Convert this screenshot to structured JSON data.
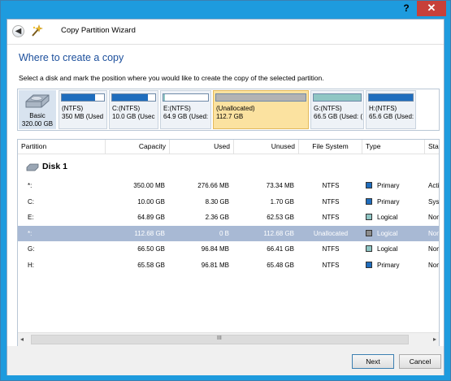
{
  "window": {
    "help_label": "?",
    "close_label": "✕"
  },
  "header": {
    "back_icon": "back-arrow-icon",
    "title": "Copy Partition Wizard"
  },
  "page": {
    "title": "Where to create a copy",
    "instruction": "Select a disk and mark the position where you would like to create the copy of the selected partition."
  },
  "disk_map": {
    "disk_label": "Basic",
    "disk_size": "320.00 GB",
    "partitions": [
      {
        "line1": "(NTFS)",
        "line2": "350 MB (Used",
        "fill_pct": 79,
        "fill_color": "#1f6dbd",
        "selected": false
      },
      {
        "line1": "C:(NTFS)",
        "line2": "10.0 GB (Usec",
        "fill_pct": 83,
        "fill_color": "#1f6dbd",
        "selected": false
      },
      {
        "line1": "E:(NTFS)",
        "line2": "64.9 GB (Used:",
        "fill_pct": 4,
        "fill_color": "#8fc6c4",
        "selected": false
      },
      {
        "line1": "(Unallocated)",
        "line2": "112.7 GB",
        "fill_pct": 100,
        "fill_color": "#b3b3b3",
        "selected": true
      },
      {
        "line1": "G:(NTFS)",
        "line2": "66.5 GB (Used: (",
        "fill_pct": 100,
        "fill_color": "#8fc6c4",
        "selected": false
      },
      {
        "line1": "H:(NTFS)",
        "line2": "65.6 GB (Used:",
        "fill_pct": 100,
        "fill_color": "#1f6dbd",
        "selected": false
      }
    ]
  },
  "table": {
    "columns": [
      "Partition",
      "Capacity",
      "Used",
      "Unused",
      "File System",
      "Type",
      "Status"
    ],
    "disk_title": "Disk 1",
    "rows": [
      {
        "partition": "*:",
        "capacity": "350.00 MB",
        "used": "276.66 MB",
        "unused": "73.34 MB",
        "fs": "NTFS",
        "type": "Primary",
        "type_color": "#1f6dbd",
        "status": "Active"
      },
      {
        "partition": "C:",
        "capacity": "10.00 GB",
        "used": "8.30 GB",
        "unused": "1.70 GB",
        "fs": "NTFS",
        "type": "Primary",
        "type_color": "#1f6dbd",
        "status": "Syster"
      },
      {
        "partition": "E:",
        "capacity": "64.89 GB",
        "used": "2.36 GB",
        "unused": "62.53 GB",
        "fs": "NTFS",
        "type": "Logical",
        "type_color": "#8fc6c4",
        "status": "None"
      },
      {
        "partition": "*:",
        "capacity": "112.68 GB",
        "used": "0 B",
        "unused": "112.68 GB",
        "fs": "Unallocated",
        "type": "Logical",
        "type_color": "#8c8c8c",
        "status": "None"
      },
      {
        "partition": "G:",
        "capacity": "66.50 GB",
        "used": "96.84 MB",
        "unused": "66.41 GB",
        "fs": "NTFS",
        "type": "Logical",
        "type_color": "#8fc6c4",
        "status": "None"
      },
      {
        "partition": "H:",
        "capacity": "65.58 GB",
        "used": "96.81 MB",
        "unused": "65.48 GB",
        "fs": "NTFS",
        "type": "Primary",
        "type_color": "#1f6dbd",
        "status": "None"
      }
    ],
    "selected_row": 3,
    "scroll": {
      "left_arrow": "◂",
      "right_arrow": "▸",
      "grip": "III"
    }
  },
  "footer": {
    "next_label": "Next",
    "cancel_label": "Cancel"
  }
}
